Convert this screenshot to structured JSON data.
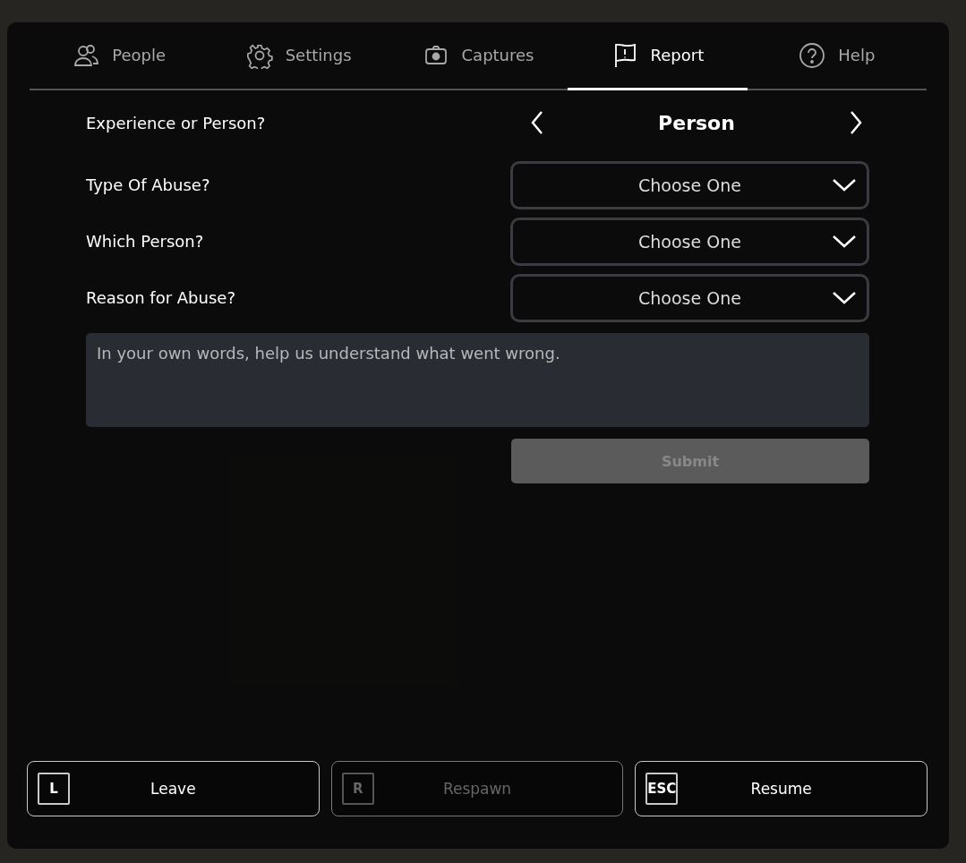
{
  "tabs": [
    {
      "label": "People",
      "selected": false
    },
    {
      "label": "Settings",
      "selected": false
    },
    {
      "label": "Captures",
      "selected": false
    },
    {
      "label": "Report",
      "selected": true
    },
    {
      "label": "Help",
      "selected": false
    }
  ],
  "report_form": {
    "target_label": "Experience or Person?",
    "target_value": "Person",
    "dropdowns": [
      {
        "label": "Type Of Abuse?",
        "placeholder": "Choose One"
      },
      {
        "label": "Which Person?",
        "placeholder": "Choose One"
      },
      {
        "label": "Reason for Abuse?",
        "placeholder": "Choose One"
      }
    ],
    "description": {
      "placeholder": "In your own words, help us understand what went wrong."
    },
    "submit": {
      "label": "Submit",
      "disabled": true
    }
  },
  "actions": [
    {
      "key": "L",
      "label": "Leave",
      "disabled": false
    },
    {
      "key": "R",
      "label": "Respawn",
      "disabled": true
    },
    {
      "key": "ESC",
      "label": "Resume",
      "disabled": false
    }
  ]
}
